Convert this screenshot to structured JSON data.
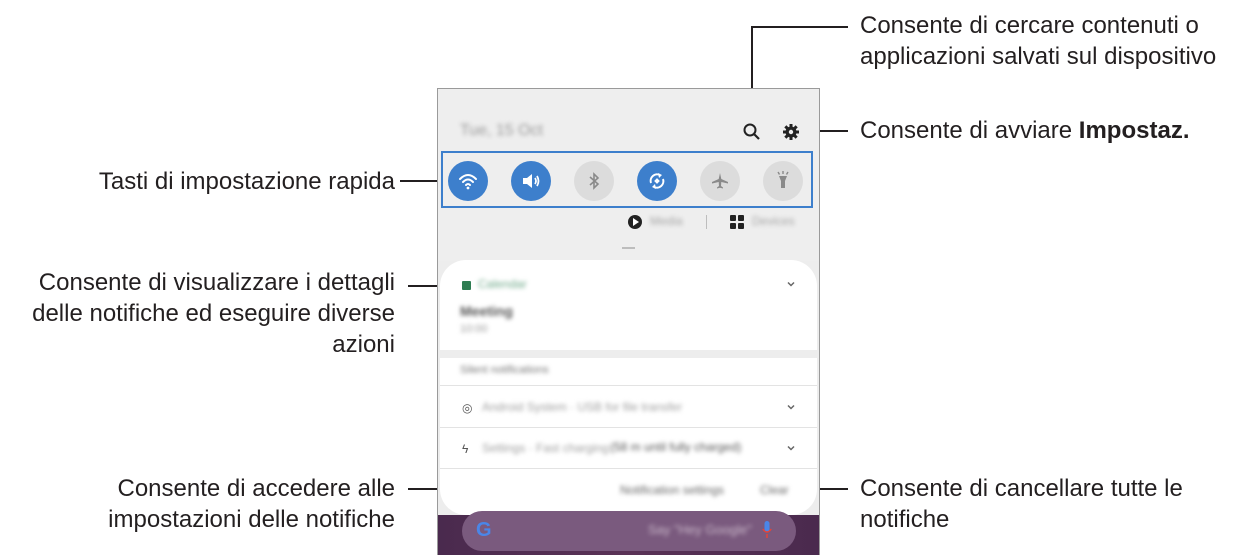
{
  "callouts": {
    "search_desc": "Consente di cercare contenuti o applicazioni salvati sul dispositivo",
    "search_line1": "Consente di cercare contenuti o",
    "search_line2": "applicazioni salvati sul dispositivo",
    "settings_prefix": "Consente di avviare ",
    "settings_bold": "Impostaz.",
    "quick_settings": "Tasti di impostazione rapida",
    "notif_details_line1": "Consente di visualizzare i dettagli",
    "notif_details_line2": "delle notifiche ed eseguire diverse",
    "notif_details_line3": "azioni",
    "notif_settings_line1": "Consente di accedere alle",
    "notif_settings_line2": "impostazioni delle notifiche",
    "clear_line1": "Consente di cancellare tutte le",
    "clear_line2": "notifiche"
  },
  "phone": {
    "datetime": "Tue, 15 Oct",
    "quick_buttons": [
      {
        "icon": "wifi-icon",
        "state": "on"
      },
      {
        "icon": "sound-icon",
        "state": "on"
      },
      {
        "icon": "bluetooth-icon",
        "state": "off"
      },
      {
        "icon": "auto-rotate-icon",
        "state": "on"
      },
      {
        "icon": "airplane-icon",
        "state": "off"
      },
      {
        "icon": "flashlight-icon",
        "state": "off"
      }
    ],
    "media_label": "Media",
    "devices_label": "Devices",
    "notification": {
      "app": "Calendar",
      "title": "Meeting",
      "subtitle": "10:00"
    },
    "silent_header": "Silent notifications",
    "rows": [
      {
        "icon": "usb-icon",
        "text": "Android System · USB for file transfer",
        "extra": ""
      },
      {
        "icon": "bolt-icon",
        "text": "Settings · Fast charging",
        "extra": "(58 m until fully charged)"
      }
    ],
    "notif_settings_btn": "Notification settings",
    "clear_btn": "Clear",
    "google_bar": {
      "letter": "G",
      "text": "Say \"Hey Google\""
    },
    "colors": {
      "accent": "#3d7fcc",
      "calendar": "#2e7d52"
    }
  }
}
